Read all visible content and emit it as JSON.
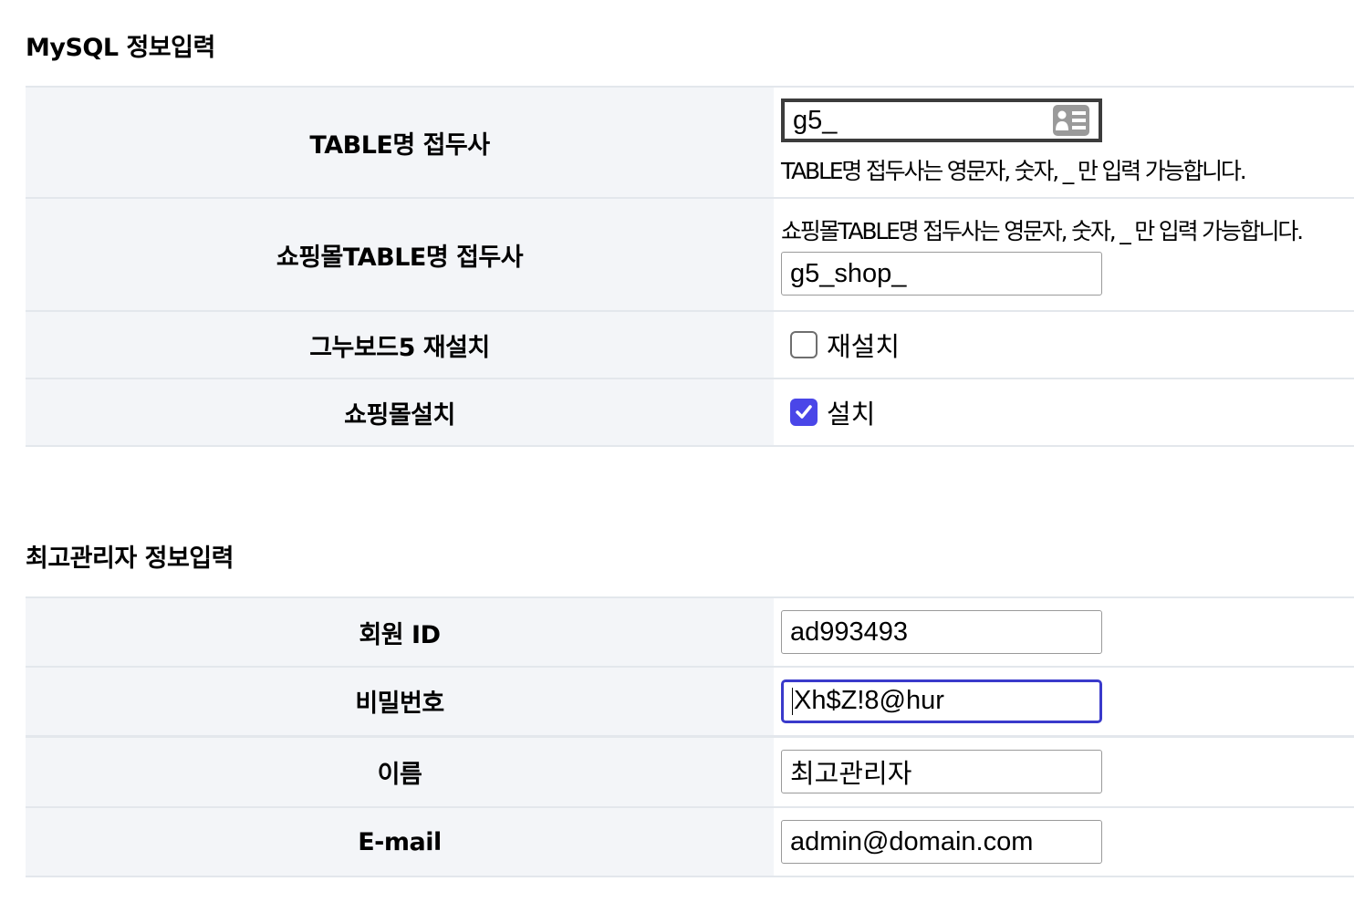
{
  "mysql_section": {
    "title": "MySQL 정보입력",
    "table_prefix": {
      "label": "TABLE명 접두사",
      "value": "g5_",
      "help": "TABLE명 접두사는 영문자, 숫자, _ 만 입력 가능합니다.",
      "icon": "contact-card-icon"
    },
    "shop_prefix": {
      "label": "쇼핑몰TABLE명 접두사",
      "help": "쇼핑몰TABLE명 접두사는 영문자, 숫자, _ 만 입력 가능합니다.",
      "value": "g5_shop_"
    },
    "reinstall": {
      "label": "그누보드5 재설치",
      "checkbox_label": "재설치",
      "checked": false
    },
    "shop_install": {
      "label": "쇼핑몰설치",
      "checkbox_label": "설치",
      "checked": true
    }
  },
  "admin_section": {
    "title": "최고관리자 정보입력",
    "member_id": {
      "label": "회원 ID",
      "value": "ad993493"
    },
    "password": {
      "label": "비밀번호",
      "value": "Xh$Z!8@hur"
    },
    "name": {
      "label": "이름",
      "value": "최고관리자"
    },
    "email": {
      "label": "E-mail",
      "value": "admin@domain.com"
    }
  },
  "colors": {
    "header_bg": "#f3f5f8",
    "border": "#e3e7ec",
    "checkbox_checked": "#4a46e8",
    "focus_border": "#3a3acb"
  }
}
